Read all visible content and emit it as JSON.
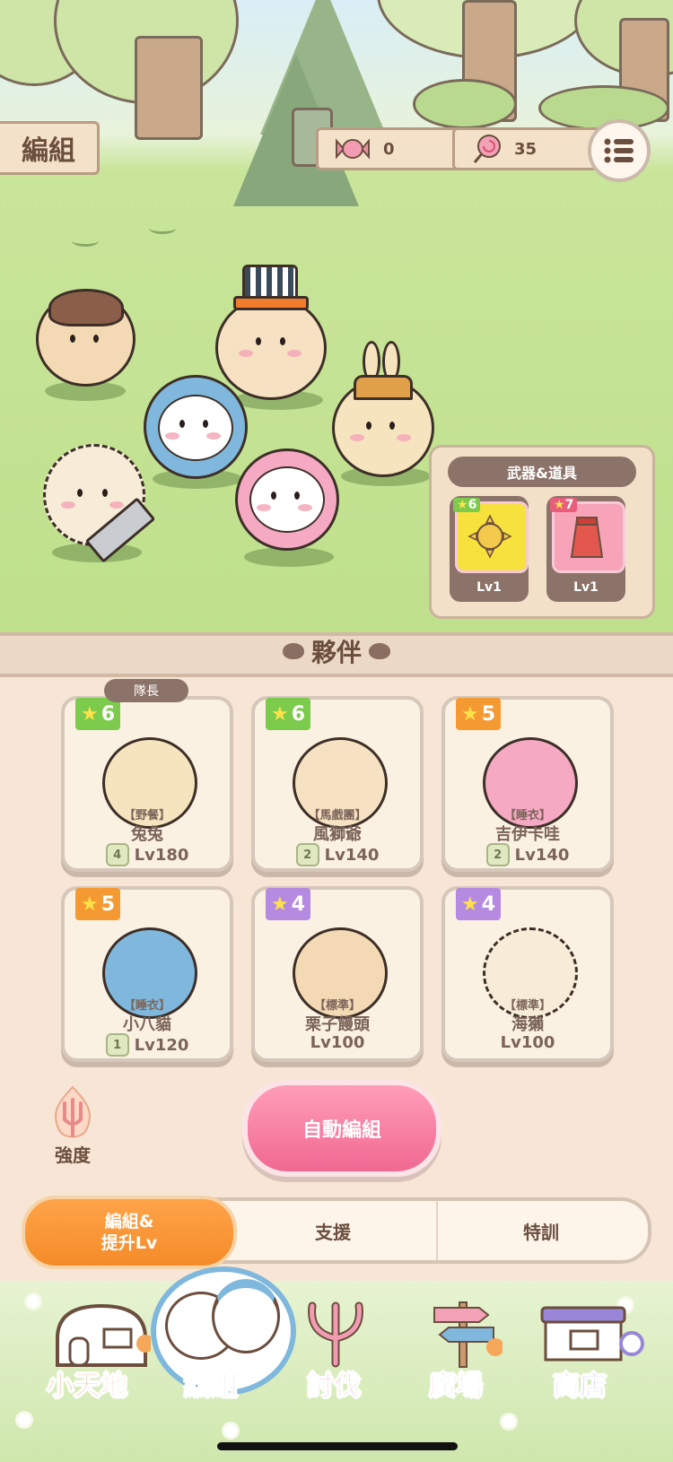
{
  "header": {
    "title": "編組",
    "candy_count": "0",
    "lollipop_count": "35",
    "menu_icon": "list-icon"
  },
  "weapons_panel": {
    "title": "武器&道具",
    "items": [
      {
        "stars": "6",
        "level": "Lv1",
        "color": "#f6e13d"
      },
      {
        "stars": "7",
        "level": "Lv1",
        "color": "#f7a3b8"
      }
    ]
  },
  "partners": {
    "title": "夥伴",
    "leader_tag": "隊長",
    "cards": [
      {
        "stars": "6",
        "badge_color": "#7ccb4d",
        "tag": "【野餐】",
        "name": "兔兔",
        "rank": "4",
        "level": "Lv180"
      },
      {
        "stars": "6",
        "badge_color": "#7ccb4d",
        "tag": "【馬戲團】",
        "name": "風獅爺",
        "rank": "2",
        "level": "Lv140"
      },
      {
        "stars": "5",
        "badge_color": "#f59a32",
        "tag": "【睡衣】",
        "name": "吉伊卡哇",
        "rank": "2",
        "level": "Lv140"
      },
      {
        "stars": "5",
        "badge_color": "#f59a32",
        "tag": "【睡衣】",
        "name": "小八貓",
        "rank": "1",
        "level": "Lv120"
      },
      {
        "stars": "4",
        "badge_color": "#b48be0",
        "tag": "【標準】",
        "name": "栗子饅頭",
        "rank": "",
        "level": "Lv100"
      },
      {
        "stars": "4",
        "badge_color": "#b48be0",
        "tag": "【標準】",
        "name": "海獺",
        "rank": "",
        "level": "Lv100"
      }
    ]
  },
  "actions": {
    "strength_label": "強度",
    "auto_button": "自動編組"
  },
  "tabs": {
    "active_line1": "編組&",
    "active_line2": "提升Lv",
    "support": "支援",
    "training": "特訓"
  },
  "nav": {
    "home": "小天地",
    "team": "編組",
    "battle": "討伐",
    "plaza": "廣場",
    "shop": "商店"
  }
}
